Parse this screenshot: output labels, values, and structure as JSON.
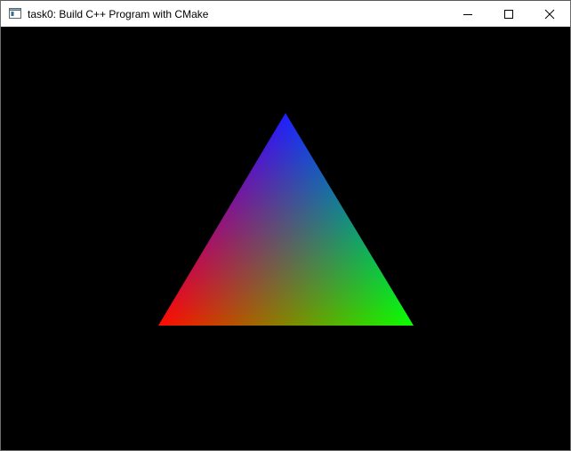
{
  "window": {
    "title": "task0: Build C++ Program with CMake"
  },
  "controls": {
    "minimize_icon": "minimize-icon",
    "maximize_icon": "maximize-icon",
    "close_icon": "close-icon"
  },
  "scene": {
    "background": "#000000",
    "vertex_colors": {
      "top": "#0000ff",
      "bottom_left": "#ff0000",
      "bottom_right": "#00ff00"
    }
  }
}
